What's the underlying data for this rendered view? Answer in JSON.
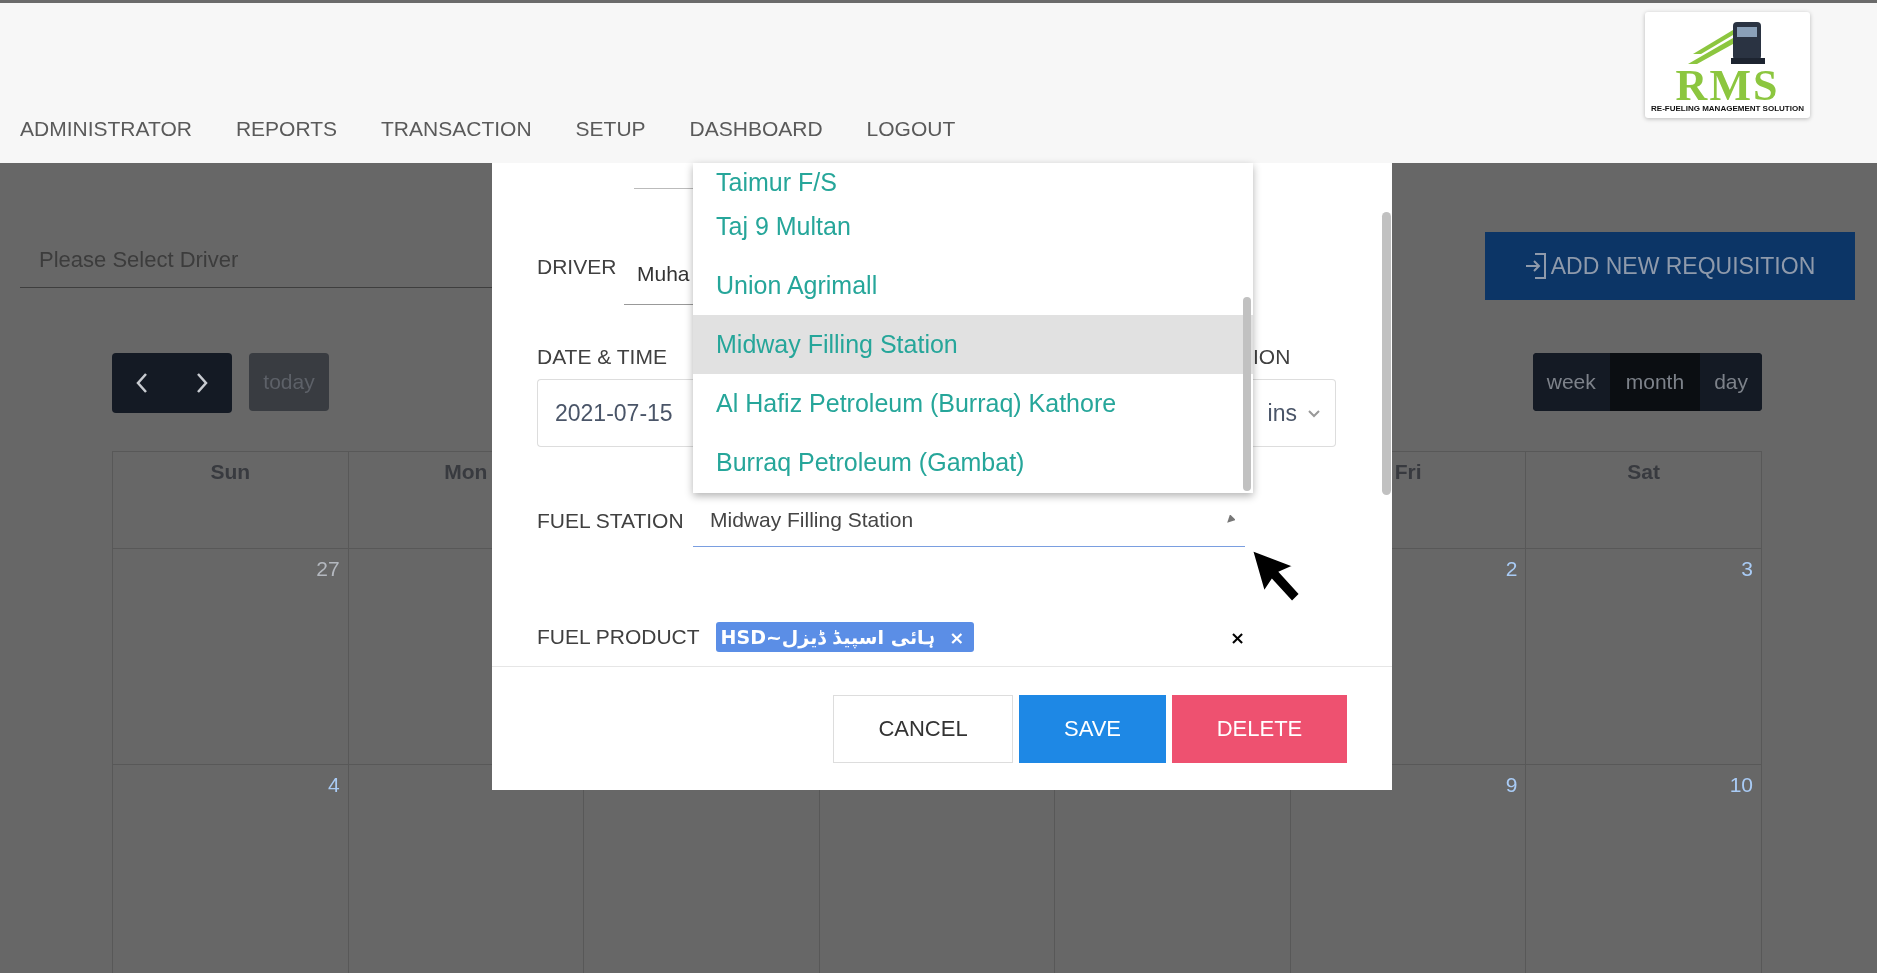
{
  "nav": {
    "items": [
      "ADMINISTRATOR",
      "REPORTS",
      "TRANSACTION",
      "SETUP",
      "DASHBOARD",
      "LOGOUT"
    ]
  },
  "logo": {
    "title": "RMS",
    "subtitle": "RE-FUELING MANAGEMENT SOLUTION"
  },
  "driver_filter": {
    "placeholder": "Please Select Driver"
  },
  "add_button": {
    "label": "ADD NEW REQUISITION"
  },
  "calendar": {
    "today_label": "today",
    "views": [
      {
        "label": "week",
        "selected": false
      },
      {
        "label": "month",
        "selected": true
      },
      {
        "label": "day",
        "selected": false
      }
    ],
    "columns": [
      {
        "header": "Sun",
        "dates": [
          {
            "text": "27",
            "muted": true
          },
          {
            "text": "4",
            "muted": false
          }
        ]
      },
      {
        "header": "Mon"
      },
      {},
      {},
      {},
      {
        "header": "Fri",
        "dates": [
          {
            "text": "2",
            "muted": false
          },
          {
            "text": "9",
            "muted": false
          }
        ]
      },
      {
        "header": "Sat",
        "dates": [
          {
            "text": "3",
            "muted": false
          },
          {
            "text": "10",
            "muted": false
          }
        ]
      }
    ]
  },
  "modal": {
    "driver": {
      "label": "DRIVER",
      "value": "Muha"
    },
    "date_time": {
      "label": "DATE & TIME",
      "value": "2021-07-15"
    },
    "duration": {
      "label": "ION",
      "value": "ins"
    },
    "fuel_station": {
      "label": "FUEL STATION",
      "value": "Midway Filling Station",
      "options": [
        {
          "label": "Taimur F/S",
          "selected": false
        },
        {
          "label": "Taj 9 Multan",
          "selected": false
        },
        {
          "label": "Union Agrimall",
          "selected": false
        },
        {
          "label": "Midway Filling Station",
          "selected": true
        },
        {
          "label": "Al Hafiz Petroleum (Burraq) Kathore",
          "selected": false
        },
        {
          "label": "Burraq Petroleum (Gambat)",
          "selected": false
        }
      ]
    },
    "fuel_product": {
      "label": "FUEL PRODUCT",
      "tags": [
        {
          "text": "HSD~ہائی اسپیڈ ڈیزل",
          "remove": "×"
        }
      ],
      "clear": "×"
    },
    "buttons": [
      {
        "label": "CANCEL",
        "kind": "cancel"
      },
      {
        "label": "SAVE",
        "kind": "save"
      },
      {
        "label": "DELETE",
        "kind": "delete"
      }
    ]
  }
}
